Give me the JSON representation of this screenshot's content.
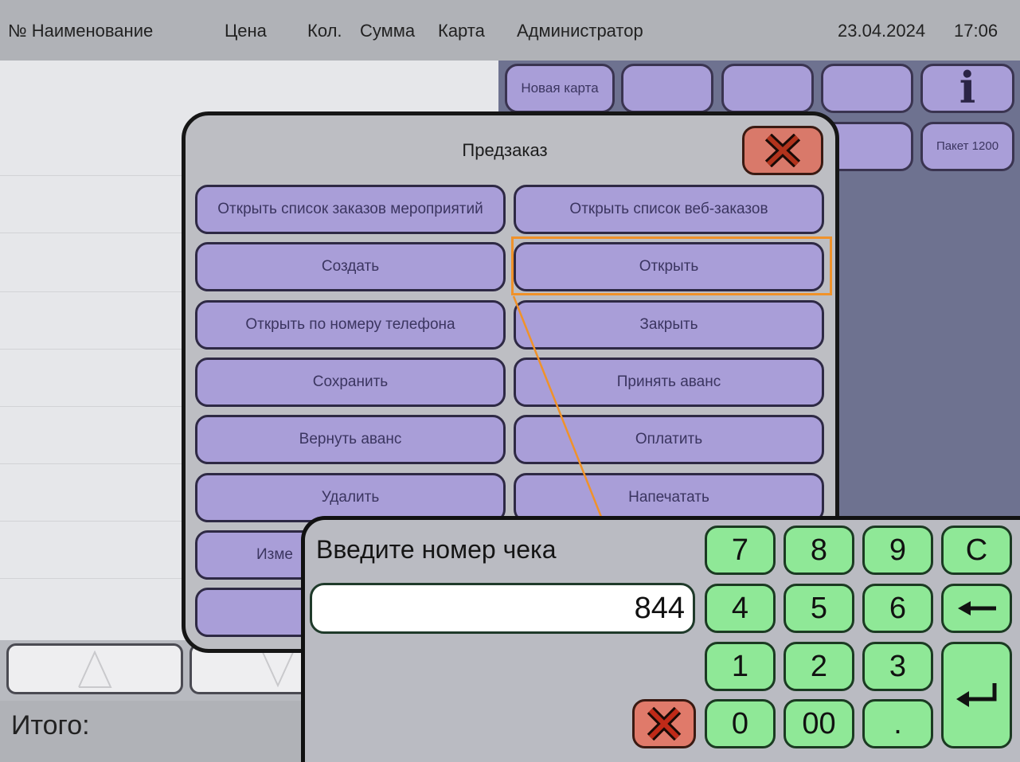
{
  "header": {
    "columns": [
      "№ Наименование",
      "Цена",
      "Кол.",
      "Сумма",
      "Карта"
    ],
    "user": "Администратор",
    "date": "23.04.2024",
    "time": "17:06"
  },
  "function_buttons": {
    "new_card": "Новая карта",
    "info_icon": "info-icon",
    "package": "Пакет 1200"
  },
  "footer": {
    "total_label": "Итого:"
  },
  "predzakaz": {
    "title": "Предзаказ",
    "buttons": [
      "Открыть список заказов мероприятий",
      "Открыть список веб-заказов",
      "Создать",
      "Открыть",
      "Открыть по номеру телефона",
      "Закрыть",
      "Сохранить",
      "Принять аванс",
      "Вернуть аванс",
      "Оплатить",
      "Удалить",
      "Напечатать",
      "Изме"
    ]
  },
  "keypad": {
    "prompt": "Введите номер чека",
    "value": "844",
    "keys": [
      "7",
      "8",
      "9",
      "C",
      "4",
      "5",
      "6",
      "1",
      "2",
      "3",
      "0",
      "00",
      "."
    ]
  },
  "colors": {
    "menu_button": "#a99ed8",
    "keypad_button": "#8fe897",
    "close_button": "#d9796a",
    "highlight": "#f0922a"
  }
}
